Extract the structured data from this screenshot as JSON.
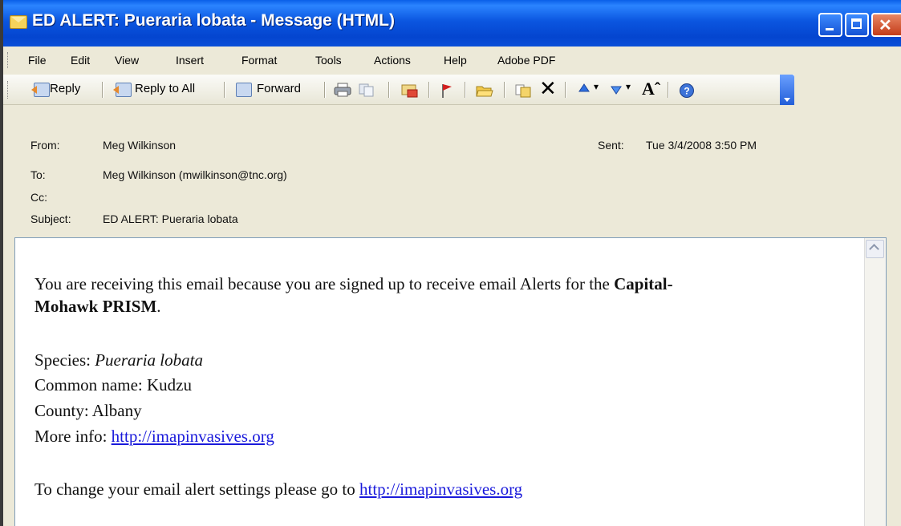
{
  "window": {
    "title": "ED ALERT: Pueraria lobata - Message (HTML)"
  },
  "menu": [
    "File",
    "Edit",
    "View",
    "Insert",
    "Format",
    "Tools",
    "Actions",
    "Help",
    "Adobe PDF"
  ],
  "toolbar": {
    "reply": "Reply",
    "reply_all": "Reply to All",
    "forward": "Forward",
    "font_icon": "Aˆ"
  },
  "header": {
    "from_label": "From:",
    "from_value": "Meg Wilkinson",
    "sent_label": "Sent:",
    "sent_value": "Tue 3/4/2008 3:50 PM",
    "to_label": "To:",
    "to_value": "Meg Wilkinson (mwilkinson@tnc.org)",
    "cc_label": "Cc:",
    "cc_value": "",
    "subject_label": "Subject:",
    "subject_value": "ED ALERT: Pueraria lobata"
  },
  "body": {
    "intro_text": "You are receiving this email because you are signed up to receive email Alerts for the ",
    "intro_bold_1": "Capital-",
    "intro_bold_2": "Mohawk PRISM",
    "intro_end": ".",
    "species_label": "Species: ",
    "species_value": "Pueraria lobata",
    "common_name": "Common name: Kudzu",
    "county": "County:  Albany",
    "more_info_label": "More info:  ",
    "more_info_link": "http://imapinvasives.org",
    "settings_text": "To change your email alert settings please go to ",
    "settings_link": "http://imapinvasives.org"
  }
}
